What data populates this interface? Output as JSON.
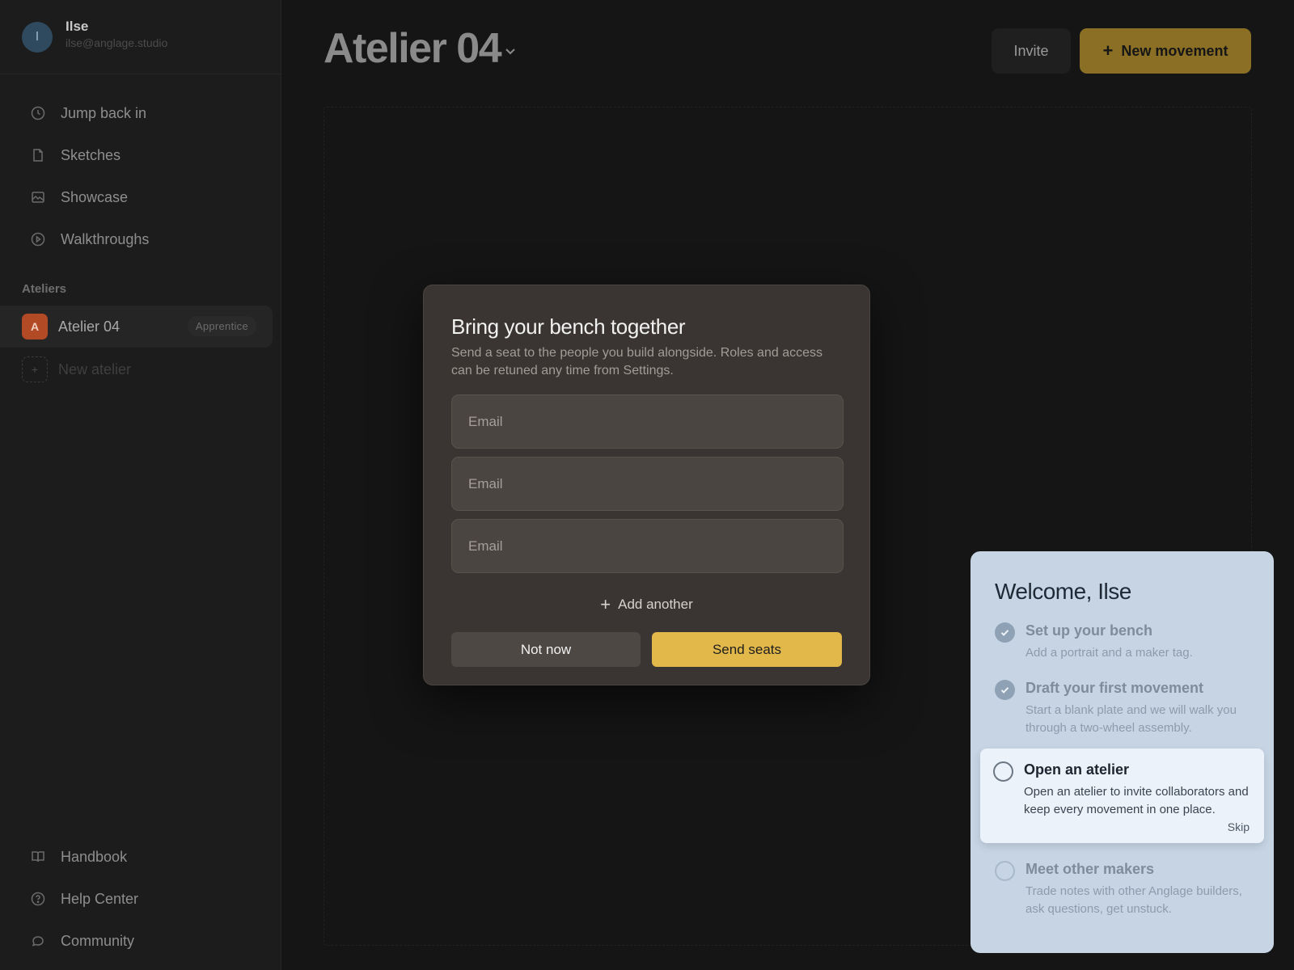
{
  "user": {
    "initial": "I",
    "name": "Ilse",
    "email": "ilse@anglage.studio"
  },
  "sidebar": {
    "nav": [
      {
        "label": "Jump back in",
        "icon": "clock-icon"
      },
      {
        "label": "Sketches",
        "icon": "file-icon"
      },
      {
        "label": "Showcase",
        "icon": "image-icon"
      },
      {
        "label": "Walkthroughs",
        "icon": "play-icon"
      }
    ],
    "section_label": "Ateliers",
    "atelier": {
      "badge": "A",
      "name": "Atelier 04",
      "role": "Apprentice"
    },
    "new_atelier": "New atelier",
    "bottom": [
      {
        "label": "Handbook",
        "icon": "book-icon"
      },
      {
        "label": "Help Center",
        "icon": "help-icon"
      },
      {
        "label": "Community",
        "icon": "chat-icon"
      }
    ]
  },
  "header": {
    "title": "Atelier 04",
    "invite": "Invite",
    "new_movement": "New movement"
  },
  "modal": {
    "title": "Bring your bench together",
    "subtitle": "Send a seat to the people you build alongside. Roles and access can be retuned any time from Settings.",
    "email_placeholder": "Email",
    "add_another": "Add another",
    "not_now": "Not now",
    "send": "Send seats"
  },
  "welcome": {
    "title": "Welcome, Ilse",
    "steps": [
      {
        "title": "Set up your bench",
        "desc": "Add a portrait and a maker tag.",
        "status": "done"
      },
      {
        "title": "Draft your first movement",
        "desc": "Start a blank plate and we will walk you through a two-wheel assembly.",
        "status": "done"
      },
      {
        "title": "Open an atelier",
        "desc": "Open an atelier to invite collaborators and keep every movement in one place.",
        "status": "active",
        "skip": "Skip"
      },
      {
        "title": "Meet other makers",
        "desc": "Trade notes with other Anglage builders, ask questions, get unstuck.",
        "status": "todo"
      }
    ]
  },
  "colors": {
    "accent": "#e3b84a",
    "accent_dim": "#8a6f25",
    "atelier_badge": "#b24a26",
    "welcome_bg": "#c6d4e4"
  }
}
